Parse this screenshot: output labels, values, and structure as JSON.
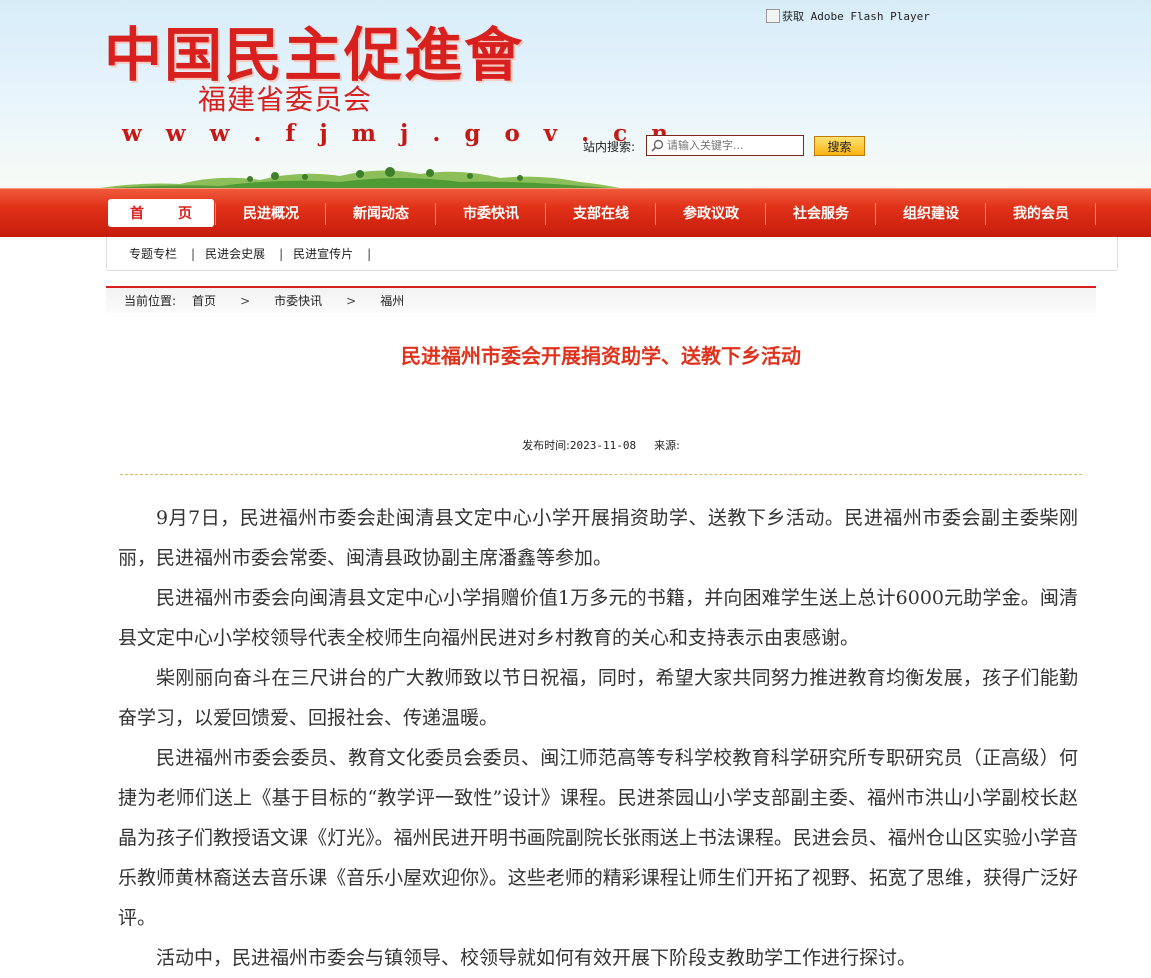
{
  "header": {
    "logo_title": "中国民主促進會",
    "logo_subtitle": "福建省委员会",
    "logo_url": "w w w . f j m j . g o v . c n",
    "flash_text": "获取 Adobe Flash Player",
    "search_label": "站内搜索:",
    "search_placeholder": "请输入关键字...",
    "search_button": "搜索"
  },
  "nav": {
    "items": [
      {
        "label": "首　页"
      },
      {
        "label": "民进概况"
      },
      {
        "label": "新闻动态"
      },
      {
        "label": "市委快讯"
      },
      {
        "label": "支部在线"
      },
      {
        "label": "参政议政"
      },
      {
        "label": "社会服务"
      },
      {
        "label": "组织建设"
      },
      {
        "label": "我的会员"
      }
    ]
  },
  "subnav": {
    "items": [
      {
        "label": "专题专栏"
      },
      {
        "label": "民进会史展"
      },
      {
        "label": "民进宣传片"
      }
    ],
    "separator": "|"
  },
  "breadcrumb": {
    "prefix": "当前位置:",
    "items": [
      "首页",
      "市委快讯",
      "福州"
    ],
    "arrow": ">"
  },
  "article": {
    "title": "民进福州市委会开展捐资助学、送教下乡活动",
    "publish_label": "发布时间:",
    "publish_date": "2023-11-08",
    "source_label": "来源:",
    "paragraphs": [
      "9月7日，民进福州市委会赴闽清县文定中心小学开展捐资助学、送教下乡活动。民进福州市委会副主委柴刚丽，民进福州市委会常委、闽清县政协副主席潘鑫等参加。",
      "民进福州市委会向闽清县文定中心小学捐赠价值1万多元的书籍，并向困难学生送上总计6000元助学金。闽清县文定中心小学校领导代表全校师生向福州民进对乡村教育的关心和支持表示由衷感谢。",
      "柴刚丽向奋斗在三尺讲台的广大教师致以节日祝福，同时，希望大家共同努力推进教育均衡发展，孩子们能勤奋学习，以爱回馈爱、回报社会、传递温暖。",
      "民进福州市委会委员、教育文化委员会委员、闽江师范高等专科学校教育科学研究所专职研究员（正高级）何捷为老师们送上《基于目标的“教学评一致性”设计》课程。民进茶园山小学支部副主委、福州市洪山小学副校长赵晶为孩子们教授语文课《灯光》。福州民进开明书画院副院长张雨送上书法课程。民进会员、福州仓山区实验小学音乐教师黄林裔送去音乐课《音乐小屋欢迎你》。这些老师的精彩课程让师生们开拓了视野、拓宽了思维，获得广泛好评。",
      "活动中，民进福州市委会与镇领导、校领导就如何有效开展下阶段支教助学工作进行探讨。"
    ]
  },
  "colors": {
    "brand_red": "#d8211e",
    "title_red": "#e0331e",
    "search_button_yellow": "#f9b516"
  }
}
